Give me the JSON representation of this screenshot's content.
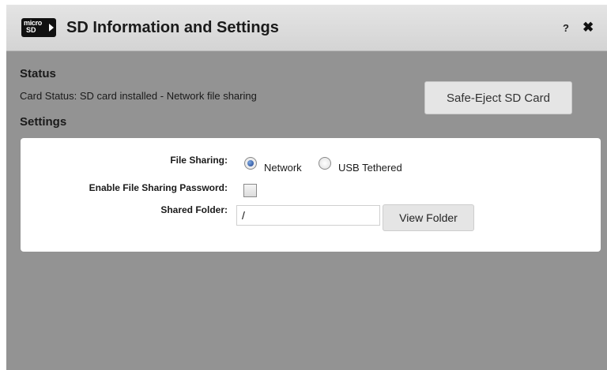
{
  "dialog": {
    "title": "SD Information and Settings",
    "icon": "microsd-icon",
    "icon_text_top": "micro",
    "icon_text_bottom": "SD",
    "help_label": "?",
    "close_label": "✖"
  },
  "status": {
    "heading": "Status",
    "card_status": "Card Status: SD card installed - Network file sharing",
    "eject_button": "Safe-Eject SD Card"
  },
  "settings": {
    "heading": "Settings",
    "file_sharing": {
      "label": "File Sharing:",
      "options": [
        "Network",
        "USB Tethered"
      ],
      "selected": "Network"
    },
    "password": {
      "label": "Enable File Sharing Password:",
      "checked": false
    },
    "shared_folder": {
      "label": "Shared Folder:",
      "value": "/",
      "button": "View Folder"
    }
  },
  "colors": {
    "dialog_bg": "#939393",
    "titlebar_bg": "#dcdcdc",
    "panel_bg": "#ffffff",
    "radio_selected": "#1b3f8f"
  }
}
